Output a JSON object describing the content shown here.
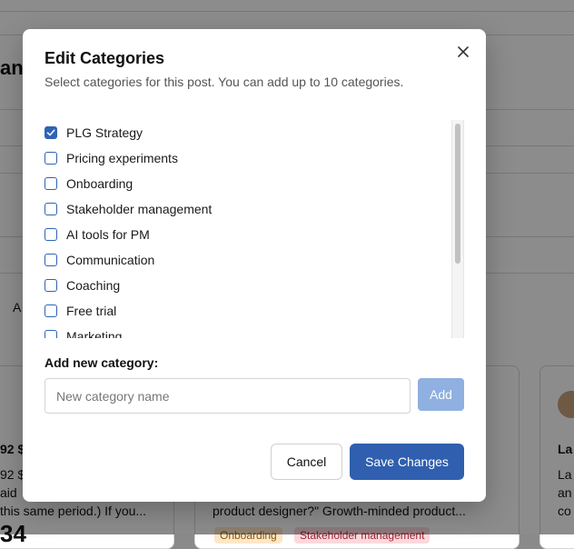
{
  "modal": {
    "title": "Edit Categories",
    "subtitle": "Select categories for this post. You can add up to 10 categories.",
    "categories": [
      {
        "label": "PLG Strategy",
        "checked": true
      },
      {
        "label": "Pricing experiments",
        "checked": false
      },
      {
        "label": "Onboarding",
        "checked": false
      },
      {
        "label": "Stakeholder management",
        "checked": false
      },
      {
        "label": "AI tools for PM",
        "checked": false
      },
      {
        "label": "Communication",
        "checked": false
      },
      {
        "label": "Coaching",
        "checked": false
      },
      {
        "label": "Free trial",
        "checked": false
      },
      {
        "label": "Marketing",
        "checked": false
      }
    ],
    "add_label": "Add new category:",
    "input_placeholder": "New category name",
    "input_value": "",
    "add_button": "Add",
    "cancel_button": "Cancel",
    "save_button": "Save Changes"
  },
  "background": {
    "fragment_heading": "anc",
    "fragment_a": "A",
    "fragment_price1": "92 $",
    "fragment_price2": "92 $",
    "fragment_paid": "aid",
    "fragment_period": "this same period.) If you...",
    "fragment_big_number": "34",
    "fragment_desc": "product designer?\" Growth-minded product...",
    "fragment_right1": "La",
    "fragment_right2": "La",
    "fragment_right3": "an",
    "fragment_right4": "co",
    "tag_onboarding": "Onboarding",
    "tag_stakeholder": "Stakeholder management"
  },
  "colors": {
    "accent": "#2f5fae",
    "add_disabled": "#8fb0e0",
    "checkbox": "#2f63b5"
  }
}
